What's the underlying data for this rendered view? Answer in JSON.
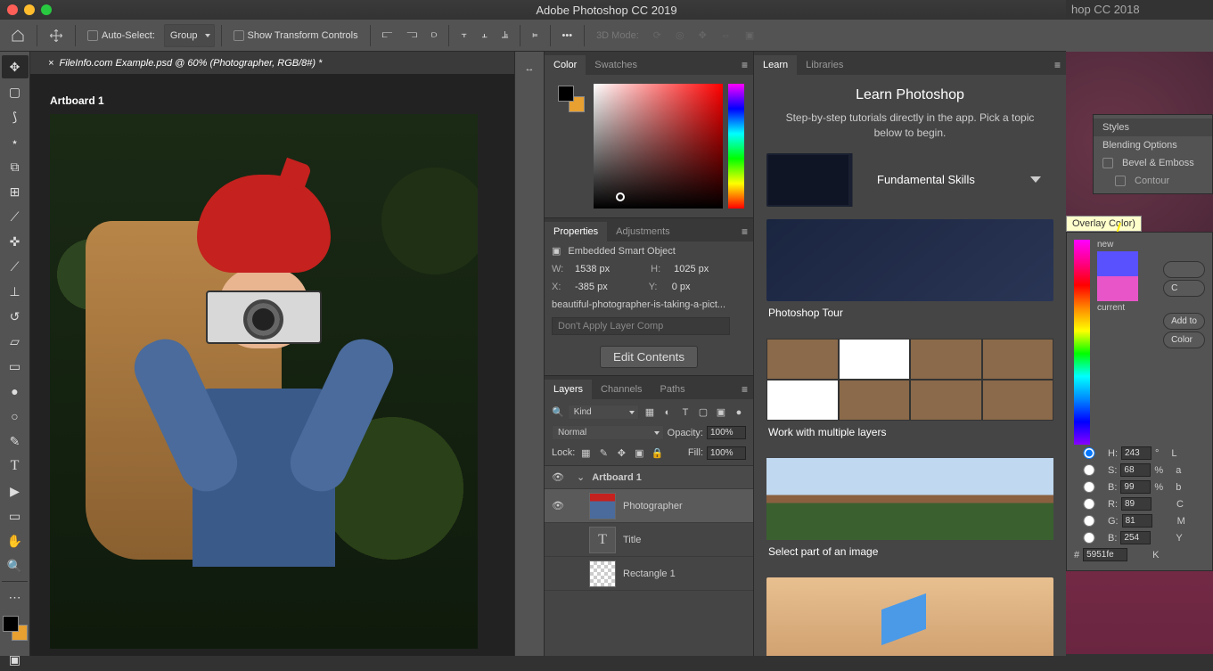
{
  "app": {
    "title": "Adobe Photoshop CC 2019",
    "bg_title": "hop CC 2018"
  },
  "options_bar": {
    "auto_select": "Auto-Select:",
    "group": "Group",
    "show_transform": "Show Transform Controls",
    "mode_3d": "3D Mode:"
  },
  "doc": {
    "tab": "FileInfo.com Example.psd @ 60% (Photographer, RGB/8#) *",
    "artboard": "Artboard 1"
  },
  "tabs": {
    "color": "Color",
    "swatches": "Swatches",
    "properties": "Properties",
    "adjustments": "Adjustments",
    "layers": "Layers",
    "channels": "Channels",
    "paths": "Paths",
    "learn": "Learn",
    "libraries": "Libraries"
  },
  "properties": {
    "type": "Embedded Smart Object",
    "w_lbl": "W:",
    "w": "1538 px",
    "h_lbl": "H:",
    "h": "1025 px",
    "x_lbl": "X:",
    "x": "-385 px",
    "y_lbl": "Y:",
    "y": "0 px",
    "filename": "beautiful-photographer-is-taking-a-pict...",
    "layer_comp": "Don't Apply Layer Comp",
    "edit": "Edit Contents"
  },
  "layers": {
    "filter": "Kind",
    "blend": "Normal",
    "opacity_lbl": "Opacity:",
    "opacity": "100%",
    "lock_lbl": "Lock:",
    "fill_lbl": "Fill:",
    "fill": "100%",
    "items": [
      {
        "name": "Artboard 1",
        "visible": true,
        "kind": "artboard"
      },
      {
        "name": "Photographer",
        "visible": true,
        "kind": "smart",
        "selected": true
      },
      {
        "name": "Title",
        "visible": false,
        "kind": "text"
      },
      {
        "name": "Rectangle 1",
        "visible": false,
        "kind": "shape"
      }
    ]
  },
  "learn": {
    "title": "Learn Photoshop",
    "sub": "Step-by-step tutorials directly in the app. Pick a topic below to begin.",
    "hero": "Fundamental Skills",
    "tuts": [
      "Photoshop Tour",
      "Work with multiple layers",
      "Select part of an image"
    ]
  },
  "fr": {
    "styles": "Styles",
    "blending": "Blending Options",
    "bevel": "Bevel & Emboss",
    "contour": "Contour",
    "overlay": "Overlay Color)",
    "new": "new",
    "current": "current",
    "add": "Add to",
    "color_btn": "Color",
    "H": "H:",
    "Hv": "243",
    "deg": "°",
    "S": "S:",
    "Sv": "68",
    "pct": "%",
    "B": "B:",
    "Bv": "99",
    "R": "R:",
    "Rv": "89",
    "G": "G:",
    "Gv": "81",
    "B2": "B:",
    "B2v": "254",
    "hex_lbl": "#",
    "hex": "5951fe",
    "L": "L",
    "a": "a",
    "b": "b",
    "C": "C",
    "M": "M",
    "Y": "Y",
    "K": "K"
  }
}
